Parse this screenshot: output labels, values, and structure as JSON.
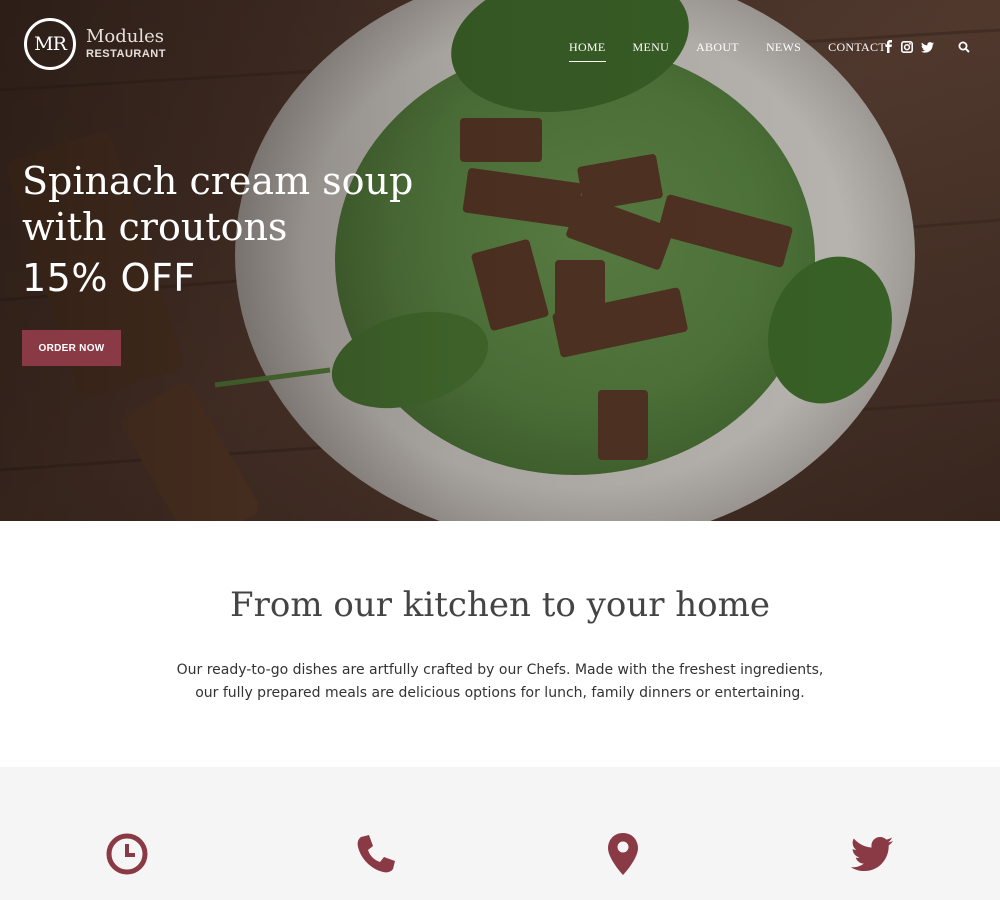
{
  "brand": {
    "monogram": "MR",
    "name": "Modules",
    "tagline": "RESTAURANT"
  },
  "nav": {
    "items": [
      {
        "label": "HOME",
        "active": true
      },
      {
        "label": "MENU",
        "active": false
      },
      {
        "label": "ABOUT",
        "active": false
      },
      {
        "label": "NEWS",
        "active": false
      },
      {
        "label": "CONTACT",
        "active": false
      }
    ],
    "social_icons": [
      "facebook-icon",
      "instagram-icon",
      "twitter-icon"
    ],
    "search_icon": "search-icon"
  },
  "hero": {
    "title_line1": "Spinach cream soup",
    "title_line2": "with croutons",
    "offer": "15% OFF",
    "cta_label": "ORDER NOW"
  },
  "intro": {
    "title": "From our kitchen to your home",
    "text_line1": "Our ready-to-go dishes are artfully crafted by our Chefs. Made with the freshest ingredients,",
    "text_line2": "our fully prepared meals are delicious options for lunch, family dinners or entertaining."
  },
  "features": {
    "icons": [
      "clock-icon",
      "phone-icon",
      "map-pin-icon",
      "twitter-icon"
    ]
  },
  "colors": {
    "accent": "#8a3a45",
    "features_bg": "#f5f5f5",
    "text": "#333333"
  }
}
